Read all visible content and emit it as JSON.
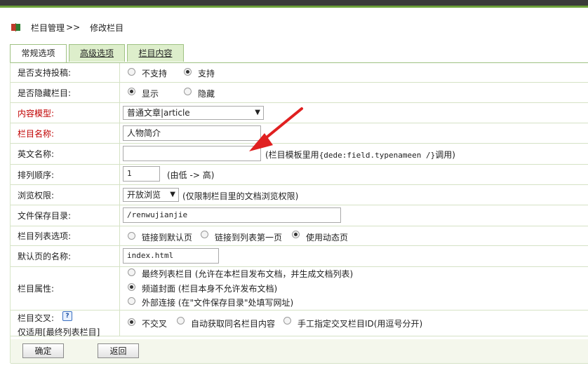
{
  "breadcrumb": {
    "section": "栏目管理",
    "separator": ">>",
    "current": "修改栏目"
  },
  "tabs": [
    {
      "label": "常规选项"
    },
    {
      "label": "高级选项"
    },
    {
      "label": "栏目内容"
    }
  ],
  "form": {
    "submit": {
      "label": "是否支持投稿:",
      "options": [
        "不支持",
        "支持"
      ],
      "selected": "支持"
    },
    "hidden": {
      "label": "是否隐藏栏目:",
      "options": [
        "显示",
        "隐藏"
      ],
      "selected": "显示"
    },
    "model": {
      "label": "内容模型:",
      "value": "普通文章|article"
    },
    "name": {
      "label": "栏目名称:",
      "value": "人物简介"
    },
    "ename": {
      "label": "英文名称:",
      "value": "",
      "hint_prefix": "(栏目模板里用",
      "hint_code": "{dede:field.typenameen /}",
      "hint_suffix": "调用)"
    },
    "order": {
      "label": "排列顺序:",
      "value": "1",
      "hint": "(由低 -> 高)"
    },
    "access": {
      "label": "浏览权限:",
      "value": "开放浏览",
      "hint": "(仅限制栏目里的文档浏览权限)"
    },
    "dir": {
      "label": "文件保存目录:",
      "value": "/renwujianjie"
    },
    "list": {
      "label": "栏目列表选项:",
      "options": [
        "链接到默认页",
        "链接到列表第一页",
        "使用动态页"
      ],
      "selected": "使用动态页"
    },
    "defpage": {
      "label": "默认页的名称:",
      "value": "index.html"
    },
    "attr": {
      "label": "栏目属性:",
      "options": [
        "最终列表栏目 (允许在本栏目发布文档，并生成文档列表)",
        "频道封面 (栏目本身不允许发布文档)",
        "外部连接 (在\"文件保存目录\"处填写网址)"
      ],
      "selected": "频道封面 (栏目本身不允许发布文档)"
    },
    "cross": {
      "label1": "栏目交叉:",
      "label2": "仅适用[最终列表栏目]",
      "options": [
        "不交叉",
        "自动获取同名栏目内容",
        "手工指定交叉栏目ID(用逗号分开)"
      ],
      "selected": "不交叉"
    }
  },
  "buttons": {
    "ok": "确定",
    "back": "返回"
  },
  "colors": {
    "accent_green": "#6ca03a",
    "tab_bg": "#ddeecb",
    "label_red": "#c00000",
    "arrow_red": "#e02020"
  }
}
